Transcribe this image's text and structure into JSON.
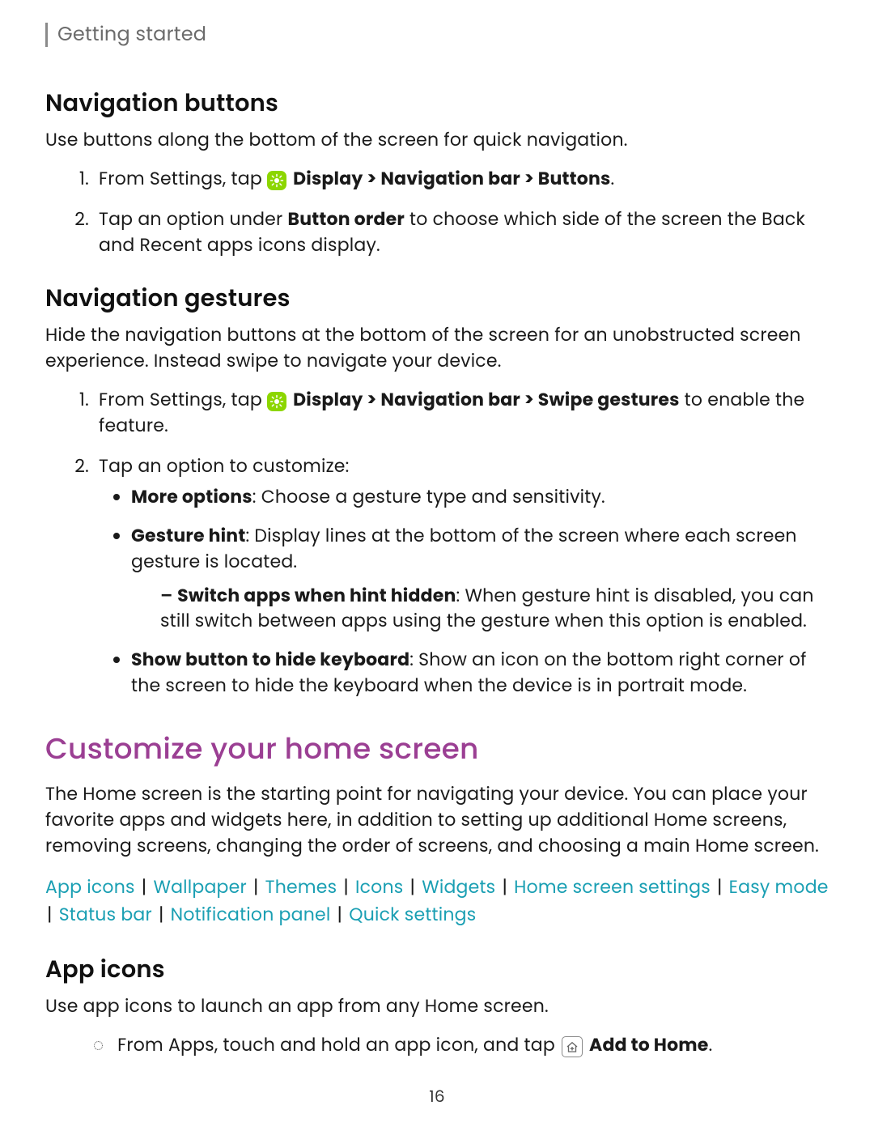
{
  "breadcrumb": "Getting started",
  "page_number": "16",
  "sections": {
    "nav_buttons": {
      "title": "Navigation buttons",
      "intro": "Use buttons along the bottom of the screen for quick navigation.",
      "step1_pre": "From Settings, tap ",
      "step1_bold": "Display > Navigation bar > Buttons",
      "step1_post": ".",
      "step2_pre": "Tap an option under ",
      "step2_bold": "Button order",
      "step2_post": " to choose which side of the screen the Back and Recent apps icons display."
    },
    "nav_gestures": {
      "title": "Navigation gestures",
      "intro": "Hide the navigation buttons at the bottom of the screen for an unobstructed screen experience. Instead swipe to navigate your device.",
      "step1_pre": "From Settings, tap ",
      "step1_bold": "Display > Navigation bar > Swipe gestures",
      "step1_post": " to enable the feature.",
      "step2": "Tap an option to customize:",
      "opt_more_bold": "More options",
      "opt_more_rest": ": Choose a gesture type and sensitivity.",
      "opt_hint_bold": "Gesture hint",
      "opt_hint_rest": ": Display lines at the bottom of the screen where each screen gesture is located.",
      "sub_switch_bold": "Switch apps when hint hidden",
      "sub_switch_rest": ": When gesture hint is disabled, you can still switch between apps using the gesture when this option is enabled.",
      "opt_kb_bold": "Show button to hide keyboard",
      "opt_kb_rest": ": Show an icon on the bottom right corner of the screen to hide the keyboard when the device is in portrait mode."
    },
    "customize": {
      "title": "Customize your home screen",
      "intro": "The Home screen is the starting point for navigating your device. You can place your favorite apps and widgets here, in addition to setting up additional Home screens, removing screens, changing the order of screens, and choosing a main Home screen.",
      "links": [
        "App icons",
        "Wallpaper",
        "Themes",
        "Icons",
        "Widgets",
        "Home screen settings",
        "Easy mode",
        "Status bar",
        "Notification panel",
        "Quick settings"
      ]
    },
    "app_icons": {
      "title": "App icons",
      "intro": "Use app icons to launch an app from any Home screen.",
      "step_pre": "From Apps, touch and hold an app icon, and tap ",
      "step_bold": "Add to Home",
      "step_post": "."
    }
  }
}
